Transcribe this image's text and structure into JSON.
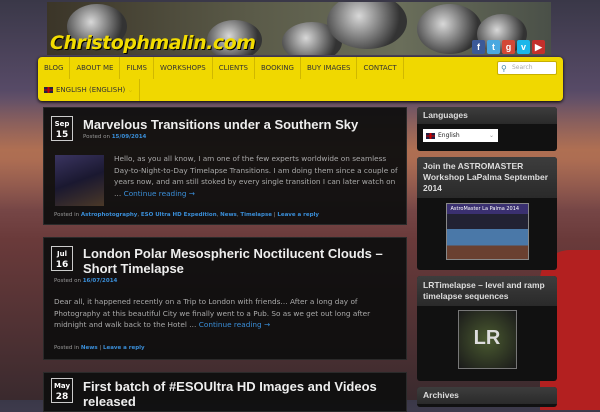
{
  "header": {
    "logo": "Christophmalin.com",
    "social": [
      "facebook",
      "twitter",
      "google-plus",
      "vimeo",
      "youtube"
    ]
  },
  "nav": {
    "items": [
      "BLOG",
      "ABOUT ME",
      "FILMS",
      "WORKSHOPS",
      "CLIENTS",
      "BOOKING",
      "BUY IMAGES",
      "CONTACT"
    ],
    "language": "ENGLISH (ENGLISH)",
    "search_placeholder": "Search"
  },
  "posts": [
    {
      "month": "Sep",
      "day": "15",
      "title": "Marvelous Transitions under a Southern Sky",
      "posted_on": "Posted on",
      "date": "15/09/2014",
      "excerpt": "Hello, as you all know, I am one of the few experts worldwide on seamless Day-to-Night-to-Day Timelapse Transitions. I am doing them since a couple of years now, and am still stoked by every single transition I can later watch on …",
      "continue": "Continue reading →",
      "posted_in": "Posted in",
      "categories": [
        "Astrophotography",
        "ESO Ultra HD Expedition",
        "News",
        "Timelapse"
      ],
      "reply": "Leave a reply"
    },
    {
      "month": "Jul",
      "day": "16",
      "title": "London Polar Mesospheric Noctilucent Clouds – Short Timelapse",
      "posted_on": "Posted on",
      "date": "16/07/2014",
      "excerpt": "Dear all, it happened recently on a Trip to London with friends… After a long day of Photography at this beautiful City we finally went to a Pub. So as we get out long after midnight and walk back to the Hotel …",
      "continue": "Continue reading →",
      "posted_in": "Posted in",
      "categories": [
        "News"
      ],
      "reply": "Leave a reply"
    },
    {
      "month": "May",
      "day": "28",
      "title": "First batch of #ESOUltra HD Images and Videos released"
    }
  ],
  "sidebar": {
    "languages_title": "Languages",
    "language_selected": "English",
    "workshop_title": "Join the ASTROMASTER Workshop LaPalma September 2014",
    "workshop_banner": "AstroMaster La Palma 2014",
    "lrt_title": "LRTimelapse – level and ramp timelapse sequences",
    "archives_title": "Archives"
  }
}
